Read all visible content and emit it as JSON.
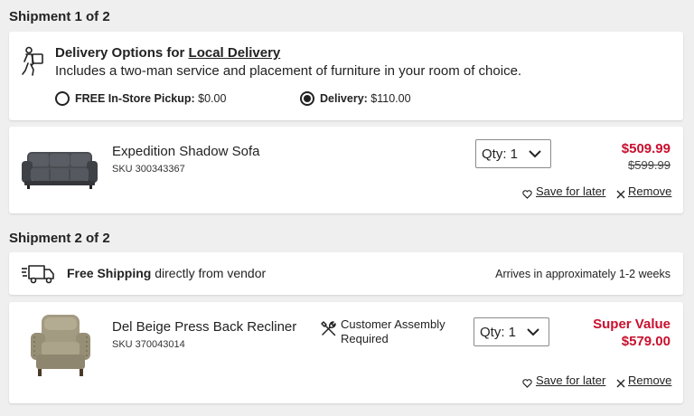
{
  "shipment1": {
    "title": "Shipment 1 of 2",
    "delivery": {
      "heading_prefix": "Delivery Options for ",
      "heading_link": "Local Delivery",
      "description": "Includes a two-man service and placement of furniture in your room of choice.",
      "options": [
        {
          "label": "FREE In-Store Pickup:",
          "price": "$0.00",
          "selected": false
        },
        {
          "label": "Delivery:",
          "price": "$110.00",
          "selected": true
        }
      ]
    },
    "item": {
      "name": "Expedition Shadow Sofa",
      "sku": "SKU 300343367",
      "qty_label": "Qty: 1",
      "sale_price": "$509.99",
      "original_price": "$599.99",
      "save_label": "Save for later",
      "remove_label": "Remove",
      "image_icon": "sofa-image"
    }
  },
  "shipment2": {
    "title": "Shipment 2 of 2",
    "shipping": {
      "bold": "Free Shipping",
      "rest": " directly from vendor",
      "arrival": "Arrives in approximately 1-2 weeks"
    },
    "item": {
      "name": "Del Beige Press Back Recliner",
      "sku": "SKU 370043014",
      "assembly": "Customer Assembly Required",
      "qty_label": "Qty: 1",
      "badge": "Super Value",
      "price": "$579.00",
      "save_label": "Save for later",
      "remove_label": "Remove",
      "image_icon": "recliner-image"
    }
  },
  "colors": {
    "accent_red": "#c8102e",
    "background": "#efefef",
    "card": "#ffffff"
  }
}
